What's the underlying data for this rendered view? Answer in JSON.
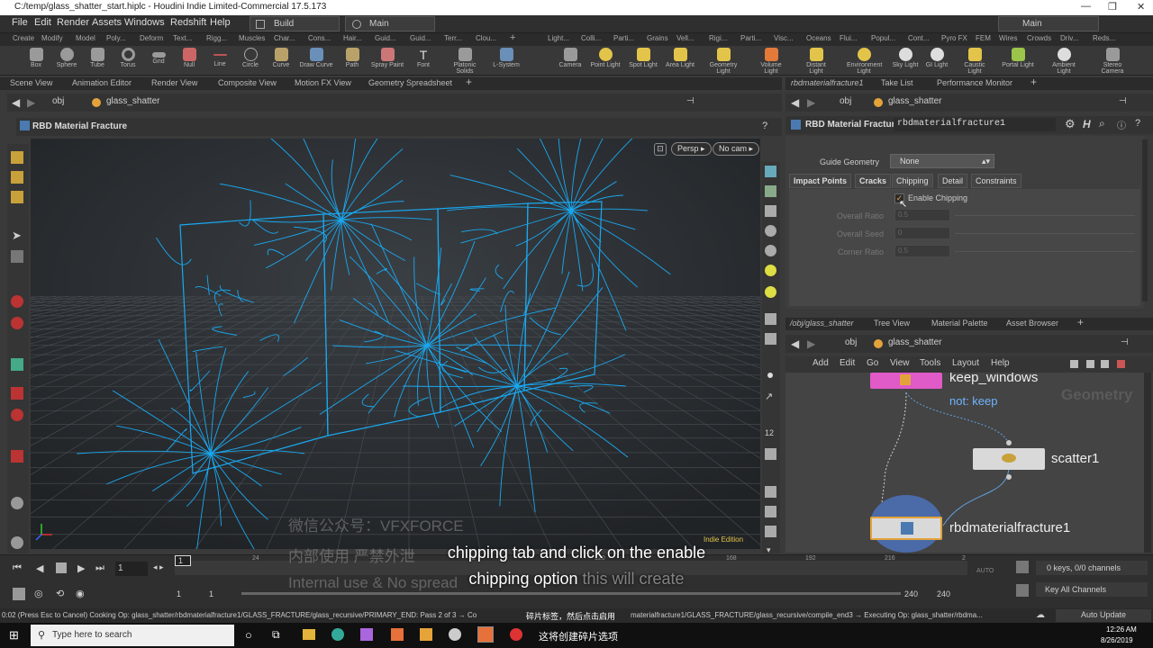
{
  "window": {
    "title": "C:/temp/glass_shatter_start.hiplc - Houdini Indie Limited-Commercial 17.5.173",
    "controls": [
      "—",
      "❐",
      "✕"
    ]
  },
  "menubar": {
    "items": [
      "File",
      "Edit",
      "Render",
      "Assets",
      "Windows",
      "Redshift",
      "Help"
    ],
    "desktop": "Build",
    "context": "Main",
    "right_desktop": "Main"
  },
  "shelf": {
    "tabs_left": [
      "Create",
      "Modify",
      "Model",
      "Poly...",
      "Deform",
      "Text...",
      "Rigg...",
      "Muscles",
      "Char...",
      "Cons...",
      "Hair...",
      "Guid...",
      "Guid...",
      "Terr...",
      "Clou..."
    ],
    "tabs_right": [
      "Light...",
      "Colli...",
      "Parti...",
      "Grains",
      "Vell...",
      "Rigi...",
      "Parti...",
      "Visc...",
      "Oceans",
      "Flui...",
      "Popul...",
      "Cont...",
      "Pyro FX",
      "FEM",
      "Wires",
      "Crowds",
      "Driv...",
      "Reds..."
    ],
    "tools_left": [
      "Box",
      "Sphere",
      "Tube",
      "Torus",
      "Grid",
      "Null",
      "Line",
      "Circle",
      "Curve",
      "Draw Curve",
      "Path",
      "Spray Paint",
      "Font",
      "Platonic Solids",
      "L-System"
    ],
    "tools_right": [
      "Camera",
      "Point Light",
      "Spot Light",
      "Area Light",
      "Geometry Light",
      "Volume Light",
      "Distant Light",
      "Environment Light",
      "Sky Light",
      "GI Light",
      "Caustic Light",
      "Portal Light",
      "Ambient Light",
      "Stereo Camera"
    ]
  },
  "left_pane": {
    "tabs": [
      "Scene View",
      "Animation Editor",
      "Render View",
      "Composite View",
      "Motion FX View",
      "Geometry Spreadsheet"
    ],
    "path_root": "obj",
    "path_node": "glass_shatter",
    "viewer_title": "RBD Material Fracture",
    "persp_button": "Persp",
    "cam_button": "No cam",
    "edition_label": "Indie Edition"
  },
  "right_pane": {
    "tabs": [
      "rbdmaterialfracture1",
      "Take List",
      "Performance Monitor"
    ],
    "path_root": "obj",
    "path_node": "glass_shatter",
    "node_type": "RBD Material Fracture",
    "node_name": "rbdmaterialfracture1",
    "guide_geometry_label": "Guide Geometry",
    "guide_geometry_value": "None",
    "param_tabs": [
      "Impact Points",
      "Cracks",
      "Chipping",
      "Detail",
      "Constraints"
    ],
    "enable_chipping_label": "Enable Chipping",
    "enable_chipping_checked": true,
    "params": [
      {
        "label": "Overall Ratio",
        "value": "0.5"
      },
      {
        "label": "Overall Seed",
        "value": "0"
      },
      {
        "label": "Corner Ratio",
        "value": "0.5"
      }
    ]
  },
  "network_pane": {
    "tabs": [
      "/obj/glass_shatter",
      "Tree View",
      "Material Palette",
      "Asset Browser"
    ],
    "path_root": "obj",
    "path_node": "glass_shatter",
    "menu": [
      "Add",
      "Edit",
      "Go",
      "View",
      "Tools",
      "Layout",
      "Help"
    ],
    "context_label": "Geometry",
    "nodes": [
      {
        "name": "keep_windows",
        "comment": "not: keep"
      },
      {
        "name": "scatter1"
      },
      {
        "name": "rbdmaterialfracture1"
      }
    ]
  },
  "timeline": {
    "frame": "1",
    "start": "1",
    "start2": "1",
    "end": "240",
    "end2": "240",
    "ticks": [
      "24",
      "72",
      "120",
      "168",
      "192",
      "216",
      "2"
    ],
    "keys_label": "0 keys, 0/0 channels",
    "key_all_label": "Key All Channels",
    "auto_label": "AUTO"
  },
  "status": {
    "text": "0:02 (Press Esc to Cancel) Cooking Op: glass_shatter/rbdmaterialfracture1/GLASS_FRACTURE/glass_recursive/PRIMARY_END: Pass 2 of 3 → Co",
    "text_right": "materialfracture1/GLASS_FRACTURE/glass_recursive/compile_end3 → Executing Op: glass_shatter/rbdma...",
    "update": "Auto Update"
  },
  "subtitles": {
    "en_line1": "chipping tab and click on the enable",
    "en_line2a": "chipping option",
    "en_line2b": "this will create",
    "zh_line1": "碎片标签，然后点击启用",
    "zh_line2": "这将创建碎片选项"
  },
  "watermark": {
    "line1": "微信公众号：VFXFORCE",
    "line2": "内部使用 严禁外泄",
    "line3": "Internal use & No spread"
  },
  "taskbar": {
    "search": "Type here to search",
    "time": "12:26 AM",
    "date": "8/26/2019"
  }
}
